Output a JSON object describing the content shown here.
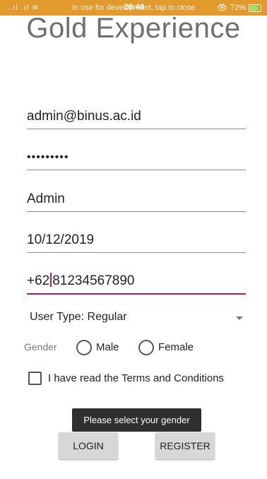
{
  "status_bar": {
    "signal": "...ıl .ıl ≋",
    "notice": "In use for development, tap to close",
    "time": "20:48",
    "battery": "72%",
    "colors": {
      "background": "#e39a2d"
    }
  },
  "app": {
    "title": "Gold Experience"
  },
  "form": {
    "email": "admin@binus.ac.id",
    "password_masked": "•••••••••",
    "username": "Admin",
    "dob": "10/12/2019",
    "phone_before_caret": "+62",
    "phone_after_caret": "81234567890",
    "user_type": "User Type: Regular",
    "gender_label": "Gender",
    "gender_options": [
      "Male",
      "Female"
    ],
    "terms_label": "I have read the Terms and Conditions"
  },
  "toast": {
    "message": "Please select your gender"
  },
  "buttons": {
    "login": "LOGIN",
    "register": "REGISTER"
  },
  "colors": {
    "accent": "#c2185b",
    "button_bg": "#d7d7d7",
    "toast_bg": "#303030"
  }
}
